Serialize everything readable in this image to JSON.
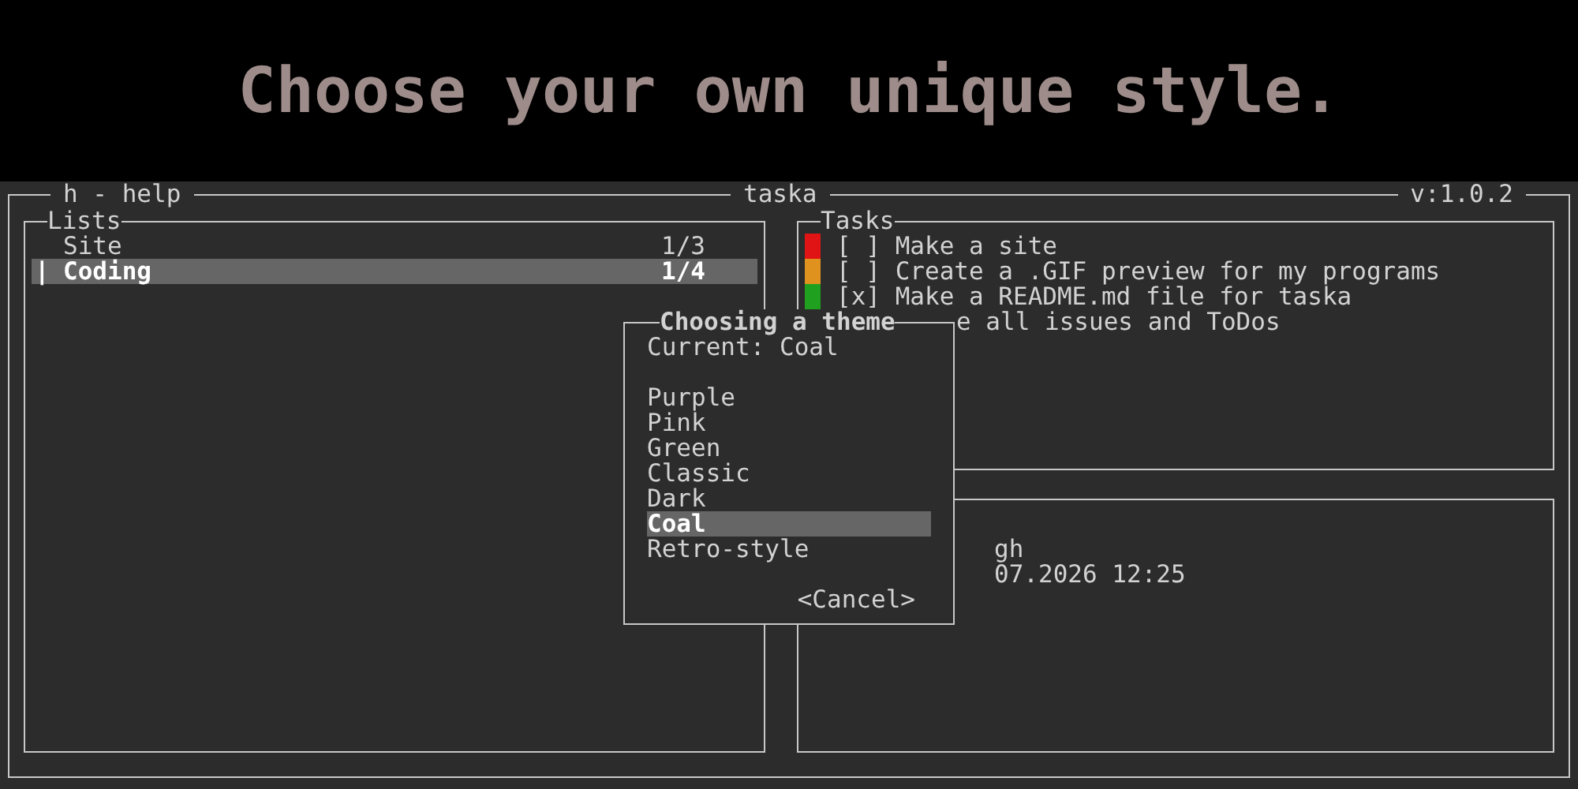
{
  "banner": {
    "title": "Choose your own unique style."
  },
  "window": {
    "help": "h - help",
    "title": "taska",
    "version": "v:1.0.2"
  },
  "lists": {
    "title": "Lists",
    "cursor": "|",
    "items": [
      {
        "name": "Site",
        "count": "1/3",
        "selected": false
      },
      {
        "name": "Coding",
        "count": "1/4",
        "selected": true
      }
    ]
  },
  "tasks": {
    "title": "Tasks",
    "items": [
      {
        "kind": "task",
        "color": "#e01414",
        "checkbox": "[ ]",
        "text": "Make a site"
      },
      {
        "kind": "task",
        "color": "#e0921e",
        "checkbox": "[ ]",
        "text": "Create a .GIF preview for my programs"
      },
      {
        "kind": "task",
        "color": "#1fa01f",
        "checkbox": "[x]",
        "text": "Make a README.md file for taska"
      },
      {
        "kind": "covered",
        "text": "e all issues and ToDos"
      }
    ]
  },
  "details": {
    "lines": [
      "gh",
      "07.2026 12:25"
    ]
  },
  "theme_dialog": {
    "title": "Choosing a theme",
    "current": "Current: Coal",
    "options": [
      {
        "label": "Purple",
        "selected": false
      },
      {
        "label": "Pink",
        "selected": false
      },
      {
        "label": "Green",
        "selected": false
      },
      {
        "label": "Classic",
        "selected": false
      },
      {
        "label": "Dark",
        "selected": false
      },
      {
        "label": "Coal",
        "selected": true
      },
      {
        "label": "Retro-style",
        "selected": false
      }
    ],
    "cancel": "<Cancel>"
  }
}
